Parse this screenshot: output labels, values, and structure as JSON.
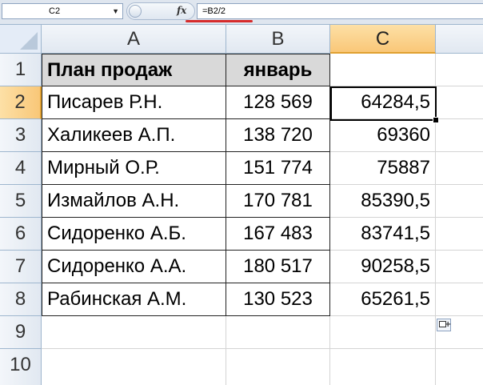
{
  "formula_bar": {
    "name_box": "C2",
    "fx_label": "fx",
    "formula": "=B2/2"
  },
  "columns": [
    "A",
    "B",
    "C"
  ],
  "rows": [
    "1",
    "2",
    "3",
    "4",
    "5",
    "6",
    "7",
    "8",
    "9",
    "10"
  ],
  "sheet": {
    "header": {
      "name": "План продаж",
      "january": "январь"
    },
    "data": [
      {
        "name": "Писарев Р.Н.",
        "jan": "128 569",
        "half": "64284,5"
      },
      {
        "name": "Халикеев А.П.",
        "jan": "138 720",
        "half": "69360"
      },
      {
        "name": "Мирный О.Р.",
        "jan": "151 774",
        "half": "75887"
      },
      {
        "name": "Измайлов А.Н.",
        "jan": "170 781",
        "half": "85390,5"
      },
      {
        "name": "Сидоренко А.Б.",
        "jan": "167 483",
        "half": "83741,5"
      },
      {
        "name": "Сидоренко А.А.",
        "jan": "180 517",
        "half": "90258,5"
      },
      {
        "name": "Рабинская А.М.",
        "jan": "130 523",
        "half": "65261,5"
      }
    ]
  },
  "colors": {
    "selected_header": "#f9c778",
    "header_fill": "#d9d9d9",
    "annotation": "#d62b2b"
  }
}
